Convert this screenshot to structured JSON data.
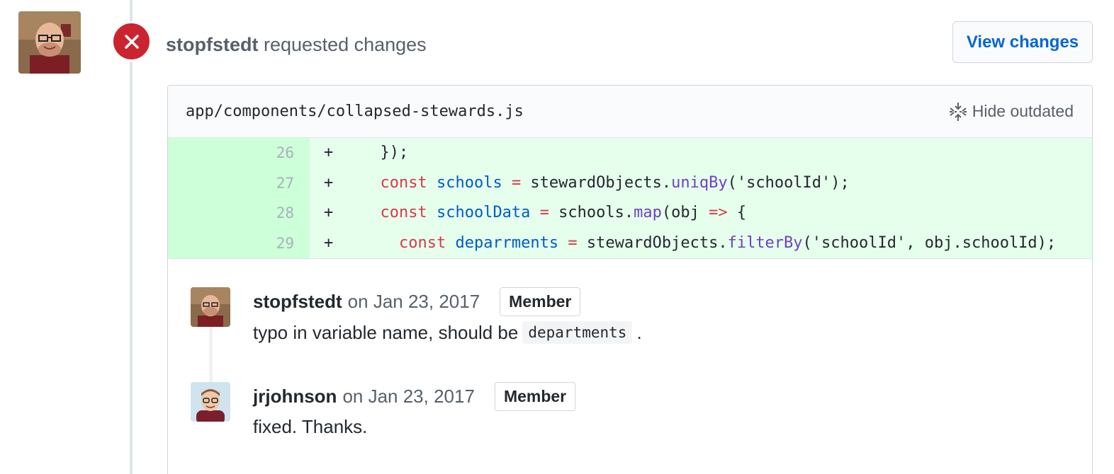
{
  "review": {
    "author": "stopfstedt",
    "action": "requested changes",
    "view_changes_label": "View changes",
    "status_color": "#cb2431"
  },
  "file": {
    "path": "app/components/collapsed-stewards.js",
    "hide_outdated_label": "Hide outdated",
    "lines": [
      {
        "num": "26",
        "sign": "+"
      },
      {
        "num": "27",
        "sign": "+"
      },
      {
        "num": "28",
        "sign": "+"
      },
      {
        "num": "29",
        "sign": "+"
      }
    ]
  },
  "comments": [
    {
      "author": "stopfstedt",
      "date": "on Jan 23, 2017",
      "badge": "Member",
      "body_before": "typo in variable name, should be",
      "body_code": "departments",
      "body_after": "."
    },
    {
      "author": "jrjohnson",
      "date": "on Jan 23, 2017",
      "badge": "Member",
      "body": "fixed. Thanks."
    }
  ],
  "colors": {
    "link": "#0366d6",
    "added_bg": "#e6ffed",
    "added_num_bg": "#cdffd8",
    "danger": "#cb2431"
  }
}
